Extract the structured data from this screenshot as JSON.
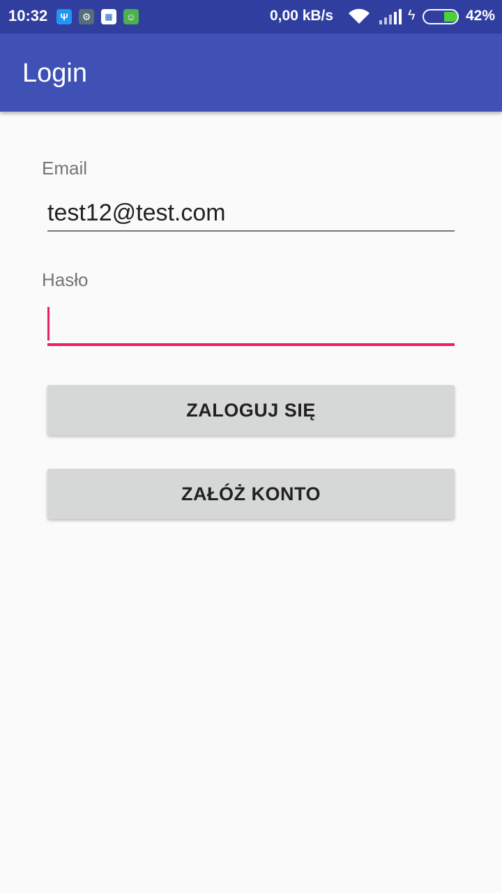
{
  "status_bar": {
    "time": "10:32",
    "notification_icons": [
      "usb-icon",
      "settings-icon",
      "calendar-icon",
      "android-icon"
    ],
    "network_speed": "0,00 kB/s",
    "battery_percent": "42%",
    "battery_level": 0.42,
    "battery_fill_color": "#4cd137"
  },
  "app_bar": {
    "title": "Login",
    "color": "#3f51b5"
  },
  "form": {
    "email_label": "Email",
    "email_value": "test12@test.com",
    "password_label": "Hasło",
    "password_value": "",
    "focus_color": "#e91e63"
  },
  "buttons": {
    "login_label": "ZALOGUJ SIĘ",
    "register_label": "ZAŁÓŻ KONTO"
  }
}
